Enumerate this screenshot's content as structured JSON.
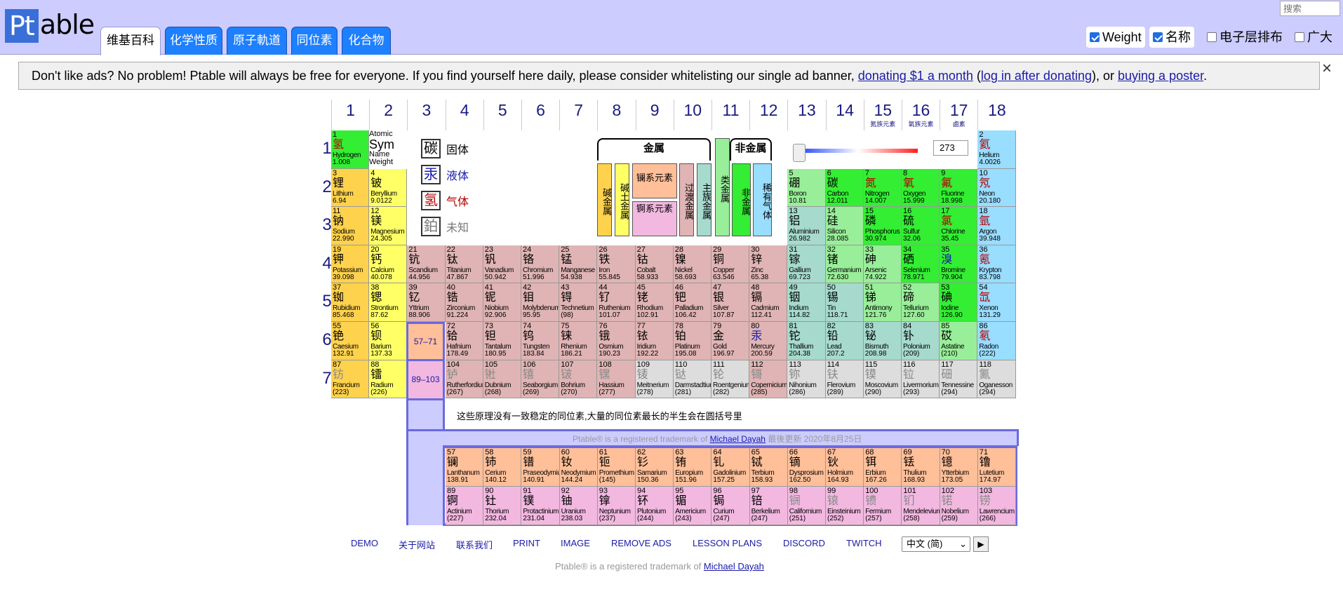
{
  "header": {
    "logo_pt": "Pt",
    "logo_rest": "able",
    "tabs": [
      "维基百科",
      "化学性质",
      "原子軌道",
      "同位素",
      "化合物"
    ],
    "search_placeholder": "搜索",
    "options": [
      {
        "label": "Weight",
        "checked": true
      },
      {
        "label": "名称",
        "checked": true
      },
      {
        "label": "电子层排布",
        "checked": false
      },
      {
        "label": "广大",
        "checked": false
      }
    ]
  },
  "ad": {
    "text1": "Don't like ads? No problem! Ptable will always be free for everyone. If you find yourself here daily, please consider whitelisting our single ad banner, ",
    "link1": "donating $1 a month",
    "text2": " (",
    "link2": "log in after donating",
    "text3": "), or ",
    "link3": "buying a poster",
    "text4": ".",
    "close": "×"
  },
  "groups": [
    "1",
    "2",
    "3",
    "4",
    "5",
    "6",
    "7",
    "8",
    "9",
    "10",
    "11",
    "12",
    "13",
    "14",
    "15",
    "16",
    "17",
    "18"
  ],
  "group_subs": {
    "15": "氮族元素",
    "16": "氧族元素",
    "17": "鹵素"
  },
  "periods": [
    "1",
    "2",
    "3",
    "4",
    "5",
    "6",
    "7"
  ],
  "key": {
    "num": "Atomic",
    "sym": "Sym",
    "name": "Name",
    "weight": "Weight"
  },
  "states": [
    {
      "sym": "碳",
      "label": "固体",
      "color": "#000000"
    },
    {
      "sym": "汞",
      "label": "液体",
      "color": "#1a1aaa"
    },
    {
      "sym": "氢",
      "label": "气体",
      "color": "#b00000"
    },
    {
      "sym": "鉑",
      "label": "未知",
      "color": "#777777"
    }
  ],
  "legend": {
    "metals": "金属",
    "metalloid": "类金属",
    "nonmetals": "非金属",
    "alkali": "碱金属",
    "alkaline": "碱土金属",
    "lanthanide": "镧系元素",
    "actinide": "锕系元素",
    "transition": "过渡金属",
    "post_transition": "主族金属",
    "other_nonmetal": "非金属",
    "noble": "稀有气体"
  },
  "temperature": "273",
  "lanth_ref": "57–71",
  "act_ref": "89–103",
  "note": "这些原理没有一致稳定的同位素,大量的同位素最长的半生会在圆括号里",
  "trademark_mid": "Ptable® is a registered trademark of ",
  "trademark_name": "Michael Dayah",
  "updated": "  最後更新 2020年8月25日",
  "footer_links": [
    "DEMO",
    "关于网站",
    "联系我们",
    "PRINT",
    "IMAGE",
    "REMOVE ADS",
    "LESSON PLANS",
    "DISCORD",
    "TWITCH"
  ],
  "language": "中文 (简)",
  "go": "▶",
  "trademark_bottom": "Ptable® is a registered trademark of ",
  "colors": {
    "alkali": "#ffd24d",
    "alkaline": "#ffff66",
    "transition": "#e0b4b4",
    "post": "#a6dacc",
    "metalloid": "#99ee99",
    "nonmetal": "#33ee33",
    "noble": "#99ddff",
    "lanthanide": "#ffbf99",
    "actinide": "#f2b8e0",
    "unknown": "#dddddd",
    "hydrogen": "#33ee33"
  },
  "elements": [
    {
      "n": "1",
      "s": "氢",
      "name": "Hydrogen",
      "w": "1.008",
      "g": 1,
      "p": 1,
      "c": "hydrogen",
      "st": "gas"
    },
    {
      "n": "2",
      "s": "氦",
      "name": "Helium",
      "w": "4.0026",
      "g": 18,
      "p": 1,
      "c": "noble",
      "st": "gas"
    },
    {
      "n": "3",
      "s": "锂",
      "name": "Lithium",
      "w": "6.94",
      "g": 1,
      "p": 2,
      "c": "alkali",
      "st": "solid"
    },
    {
      "n": "4",
      "s": "铍",
      "name": "Beryllium",
      "w": "9.0122",
      "g": 2,
      "p": 2,
      "c": "alkaline",
      "st": "solid"
    },
    {
      "n": "5",
      "s": "硼",
      "name": "Boron",
      "w": "10.81",
      "g": 13,
      "p": 2,
      "c": "metalloid",
      "st": "solid"
    },
    {
      "n": "6",
      "s": "碳",
      "name": "Carbon",
      "w": "12.011",
      "g": 14,
      "p": 2,
      "c": "nonmetal",
      "st": "solid"
    },
    {
      "n": "7",
      "s": "氮",
      "name": "Nitrogen",
      "w": "14.007",
      "g": 15,
      "p": 2,
      "c": "nonmetal",
      "st": "gas"
    },
    {
      "n": "8",
      "s": "氧",
      "name": "Oxygen",
      "w": "15.999",
      "g": 16,
      "p": 2,
      "c": "nonmetal",
      "st": "gas"
    },
    {
      "n": "9",
      "s": "氟",
      "name": "Fluorine",
      "w": "18.998",
      "g": 17,
      "p": 2,
      "c": "nonmetal",
      "st": "gas"
    },
    {
      "n": "10",
      "s": "氖",
      "name": "Neon",
      "w": "20.180",
      "g": 18,
      "p": 2,
      "c": "noble",
      "st": "gas"
    },
    {
      "n": "11",
      "s": "钠",
      "name": "Sodium",
      "w": "22.990",
      "g": 1,
      "p": 3,
      "c": "alkali",
      "st": "solid"
    },
    {
      "n": "12",
      "s": "镁",
      "name": "Magnesium",
      "w": "24.305",
      "g": 2,
      "p": 3,
      "c": "alkaline",
      "st": "solid"
    },
    {
      "n": "13",
      "s": "铝",
      "name": "Aluminium",
      "w": "26.982",
      "g": 13,
      "p": 3,
      "c": "post",
      "st": "solid"
    },
    {
      "n": "14",
      "s": "硅",
      "name": "Silicon",
      "w": "28.085",
      "g": 14,
      "p": 3,
      "c": "metalloid",
      "st": "solid"
    },
    {
      "n": "15",
      "s": "磷",
      "name": "Phosphorus",
      "w": "30.974",
      "g": 15,
      "p": 3,
      "c": "nonmetal",
      "st": "solid"
    },
    {
      "n": "16",
      "s": "硫",
      "name": "Sulfur",
      "w": "32.06",
      "g": 16,
      "p": 3,
      "c": "nonmetal",
      "st": "solid"
    },
    {
      "n": "17",
      "s": "氯",
      "name": "Chlorine",
      "w": "35.45",
      "g": 17,
      "p": 3,
      "c": "nonmetal",
      "st": "gas"
    },
    {
      "n": "18",
      "s": "氩",
      "name": "Argon",
      "w": "39.948",
      "g": 18,
      "p": 3,
      "c": "noble",
      "st": "gas"
    },
    {
      "n": "19",
      "s": "钾",
      "name": "Potassium",
      "w": "39.098",
      "g": 1,
      "p": 4,
      "c": "alkali",
      "st": "solid"
    },
    {
      "n": "20",
      "s": "钙",
      "name": "Calcium",
      "w": "40.078",
      "g": 2,
      "p": 4,
      "c": "alkaline",
      "st": "solid"
    },
    {
      "n": "21",
      "s": "钪",
      "name": "Scandium",
      "w": "44.956",
      "g": 3,
      "p": 4,
      "c": "transition",
      "st": "solid"
    },
    {
      "n": "22",
      "s": "钛",
      "name": "Titanium",
      "w": "47.867",
      "g": 4,
      "p": 4,
      "c": "transition",
      "st": "solid"
    },
    {
      "n": "23",
      "s": "钒",
      "name": "Vanadium",
      "w": "50.942",
      "g": 5,
      "p": 4,
      "c": "transition",
      "st": "solid"
    },
    {
      "n": "24",
      "s": "铬",
      "name": "Chromium",
      "w": "51.996",
      "g": 6,
      "p": 4,
      "c": "transition",
      "st": "solid"
    },
    {
      "n": "25",
      "s": "锰",
      "name": "Manganese",
      "w": "54.938",
      "g": 7,
      "p": 4,
      "c": "transition",
      "st": "solid"
    },
    {
      "n": "26",
      "s": "铁",
      "name": "Iron",
      "w": "55.845",
      "g": 8,
      "p": 4,
      "c": "transition",
      "st": "solid"
    },
    {
      "n": "27",
      "s": "钴",
      "name": "Cobalt",
      "w": "58.933",
      "g": 9,
      "p": 4,
      "c": "transition",
      "st": "solid"
    },
    {
      "n": "28",
      "s": "镍",
      "name": "Nickel",
      "w": "58.693",
      "g": 10,
      "p": 4,
      "c": "transition",
      "st": "solid"
    },
    {
      "n": "29",
      "s": "铜",
      "name": "Copper",
      "w": "63.546",
      "g": 11,
      "p": 4,
      "c": "transition",
      "st": "solid"
    },
    {
      "n": "30",
      "s": "锌",
      "name": "Zinc",
      "w": "65.38",
      "g": 12,
      "p": 4,
      "c": "transition",
      "st": "solid"
    },
    {
      "n": "31",
      "s": "镓",
      "name": "Gallium",
      "w": "69.723",
      "g": 13,
      "p": 4,
      "c": "post",
      "st": "solid"
    },
    {
      "n": "32",
      "s": "锗",
      "name": "Germanium",
      "w": "72.630",
      "g": 14,
      "p": 4,
      "c": "metalloid",
      "st": "solid"
    },
    {
      "n": "33",
      "s": "砷",
      "name": "Arsenic",
      "w": "74.922",
      "g": 15,
      "p": 4,
      "c": "metalloid",
      "st": "solid"
    },
    {
      "n": "34",
      "s": "硒",
      "name": "Selenium",
      "w": "78.971",
      "g": 16,
      "p": 4,
      "c": "nonmetal",
      "st": "solid"
    },
    {
      "n": "35",
      "s": "溴",
      "name": "Bromine",
      "w": "79.904",
      "g": 17,
      "p": 4,
      "c": "nonmetal",
      "st": "liquid"
    },
    {
      "n": "36",
      "s": "氪",
      "name": "Krypton",
      "w": "83.798",
      "g": 18,
      "p": 4,
      "c": "noble",
      "st": "gas"
    },
    {
      "n": "37",
      "s": "铷",
      "name": "Rubidium",
      "w": "85.468",
      "g": 1,
      "p": 5,
      "c": "alkali",
      "st": "solid"
    },
    {
      "n": "38",
      "s": "锶",
      "name": "Strontium",
      "w": "87.62",
      "g": 2,
      "p": 5,
      "c": "alkaline",
      "st": "solid"
    },
    {
      "n": "39",
      "s": "钇",
      "name": "Yttrium",
      "w": "88.906",
      "g": 3,
      "p": 5,
      "c": "transition",
      "st": "solid"
    },
    {
      "n": "40",
      "s": "锆",
      "name": "Zirconium",
      "w": "91.224",
      "g": 4,
      "p": 5,
      "c": "transition",
      "st": "solid"
    },
    {
      "n": "41",
      "s": "铌",
      "name": "Niobium",
      "w": "92.906",
      "g": 5,
      "p": 5,
      "c": "transition",
      "st": "solid"
    },
    {
      "n": "42",
      "s": "钼",
      "name": "Molybdenum",
      "w": "95.95",
      "g": 6,
      "p": 5,
      "c": "transition",
      "st": "solid"
    },
    {
      "n": "43",
      "s": "锝",
      "name": "Technetium",
      "w": "(98)",
      "g": 7,
      "p": 5,
      "c": "transition",
      "st": "solid"
    },
    {
      "n": "44",
      "s": "钌",
      "name": "Ruthenium",
      "w": "101.07",
      "g": 8,
      "p": 5,
      "c": "transition",
      "st": "solid"
    },
    {
      "n": "45",
      "s": "铑",
      "name": "Rhodium",
      "w": "102.91",
      "g": 9,
      "p": 5,
      "c": "transition",
      "st": "solid"
    },
    {
      "n": "46",
      "s": "钯",
      "name": "Palladium",
      "w": "106.42",
      "g": 10,
      "p": 5,
      "c": "transition",
      "st": "solid"
    },
    {
      "n": "47",
      "s": "银",
      "name": "Silver",
      "w": "107.87",
      "g": 11,
      "p": 5,
      "c": "transition",
      "st": "solid"
    },
    {
      "n": "48",
      "s": "镉",
      "name": "Cadmium",
      "w": "112.41",
      "g": 12,
      "p": 5,
      "c": "transition",
      "st": "solid"
    },
    {
      "n": "49",
      "s": "铟",
      "name": "Indium",
      "w": "114.82",
      "g": 13,
      "p": 5,
      "c": "post",
      "st": "solid"
    },
    {
      "n": "50",
      "s": "锡",
      "name": "Tin",
      "w": "118.71",
      "g": 14,
      "p": 5,
      "c": "post",
      "st": "solid"
    },
    {
      "n": "51",
      "s": "锑",
      "name": "Antimony",
      "w": "121.76",
      "g": 15,
      "p": 5,
      "c": "metalloid",
      "st": "solid"
    },
    {
      "n": "52",
      "s": "碲",
      "name": "Tellurium",
      "w": "127.60",
      "g": 16,
      "p": 5,
      "c": "metalloid",
      "st": "solid"
    },
    {
      "n": "53",
      "s": "碘",
      "name": "Iodine",
      "w": "126.90",
      "g": 17,
      "p": 5,
      "c": "nonmetal",
      "st": "solid"
    },
    {
      "n": "54",
      "s": "氙",
      "name": "Xenon",
      "w": "131.29",
      "g": 18,
      "p": 5,
      "c": "noble",
      "st": "gas"
    },
    {
      "n": "55",
      "s": "铯",
      "name": "Caesium",
      "w": "132.91",
      "g": 1,
      "p": 6,
      "c": "alkali",
      "st": "solid"
    },
    {
      "n": "56",
      "s": "钡",
      "name": "Barium",
      "w": "137.33",
      "g": 2,
      "p": 6,
      "c": "alkaline",
      "st": "solid"
    },
    {
      "n": "72",
      "s": "铪",
      "name": "Hafnium",
      "w": "178.49",
      "g": 4,
      "p": 6,
      "c": "transition",
      "st": "solid"
    },
    {
      "n": "73",
      "s": "钽",
      "name": "Tantalum",
      "w": "180.95",
      "g": 5,
      "p": 6,
      "c": "transition",
      "st": "solid"
    },
    {
      "n": "74",
      "s": "钨",
      "name": "Tungsten",
      "w": "183.84",
      "g": 6,
      "p": 6,
      "c": "transition",
      "st": "solid"
    },
    {
      "n": "75",
      "s": "铼",
      "name": "Rhenium",
      "w": "186.21",
      "g": 7,
      "p": 6,
      "c": "transition",
      "st": "solid"
    },
    {
      "n": "76",
      "s": "锇",
      "name": "Osmium",
      "w": "190.23",
      "g": 8,
      "p": 6,
      "c": "transition",
      "st": "solid"
    },
    {
      "n": "77",
      "s": "铱",
      "name": "Iridium",
      "w": "192.22",
      "g": 9,
      "p": 6,
      "c": "transition",
      "st": "solid"
    },
    {
      "n": "78",
      "s": "铂",
      "name": "Platinum",
      "w": "195.08",
      "g": 10,
      "p": 6,
      "c": "transition",
      "st": "solid"
    },
    {
      "n": "79",
      "s": "金",
      "name": "Gold",
      "w": "196.97",
      "g": 11,
      "p": 6,
      "c": "transition",
      "st": "solid"
    },
    {
      "n": "80",
      "s": "汞",
      "name": "Mercury",
      "w": "200.59",
      "g": 12,
      "p": 6,
      "c": "transition",
      "st": "liquid"
    },
    {
      "n": "81",
      "s": "铊",
      "name": "Thallium",
      "w": "204.38",
      "g": 13,
      "p": 6,
      "c": "post",
      "st": "solid"
    },
    {
      "n": "82",
      "s": "铅",
      "name": "Lead",
      "w": "207.2",
      "g": 14,
      "p": 6,
      "c": "post",
      "st": "solid"
    },
    {
      "n": "83",
      "s": "铋",
      "name": "Bismuth",
      "w": "208.98",
      "g": 15,
      "p": 6,
      "c": "post",
      "st": "solid"
    },
    {
      "n": "84",
      "s": "钋",
      "name": "Polonium",
      "w": "(209)",
      "g": 16,
      "p": 6,
      "c": "post",
      "st": "solid"
    },
    {
      "n": "85",
      "s": "砹",
      "name": "Astatine",
      "w": "(210)",
      "g": 17,
      "p": 6,
      "c": "metalloid",
      "st": "solid"
    },
    {
      "n": "86",
      "s": "氡",
      "name": "Radon",
      "w": "(222)",
      "g": 18,
      "p": 6,
      "c": "noble",
      "st": "gas"
    },
    {
      "n": "87",
      "s": "钫",
      "name": "Francium",
      "w": "(223)",
      "g": 1,
      "p": 7,
      "c": "alkali",
      "st": "unknown"
    },
    {
      "n": "88",
      "s": "镭",
      "name": "Radium",
      "w": "(226)",
      "g": 2,
      "p": 7,
      "c": "alkaline",
      "st": "solid"
    },
    {
      "n": "104",
      "s": "𬬻",
      "name": "Rutherfordium",
      "w": "(267)",
      "g": 4,
      "p": 7,
      "c": "transition",
      "st": "unknown"
    },
    {
      "n": "105",
      "s": "𬭊",
      "name": "Dubnium",
      "w": "(268)",
      "g": 5,
      "p": 7,
      "c": "transition",
      "st": "unknown"
    },
    {
      "n": "106",
      "s": "𬭳",
      "name": "Seaborgium",
      "w": "(269)",
      "g": 6,
      "p": 7,
      "c": "transition",
      "st": "unknown"
    },
    {
      "n": "107",
      "s": "𬭛",
      "name": "Bohrium",
      "w": "(270)",
      "g": 7,
      "p": 7,
      "c": "transition",
      "st": "unknown"
    },
    {
      "n": "108",
      "s": "𬭶",
      "name": "Hassium",
      "w": "(277)",
      "g": 8,
      "p": 7,
      "c": "transition",
      "st": "unknown"
    },
    {
      "n": "109",
      "s": "鿏",
      "name": "Meitnerium",
      "w": "(278)",
      "g": 9,
      "p": 7,
      "c": "unknown",
      "st": "unknown"
    },
    {
      "n": "110",
      "s": "𫟼",
      "name": "Darmstadtium",
      "w": "(281)",
      "g": 10,
      "p": 7,
      "c": "unknown",
      "st": "unknown"
    },
    {
      "n": "111",
      "s": "𬬭",
      "name": "Roentgenium",
      "w": "(282)",
      "g": 11,
      "p": 7,
      "c": "unknown",
      "st": "unknown"
    },
    {
      "n": "112",
      "s": "鿔",
      "name": "Copernicium",
      "w": "(285)",
      "g": 12,
      "p": 7,
      "c": "transition",
      "st": "unknown"
    },
    {
      "n": "113",
      "s": "鿭",
      "name": "Nihonium",
      "w": "(286)",
      "g": 13,
      "p": 7,
      "c": "unknown",
      "st": "unknown"
    },
    {
      "n": "114",
      "s": "𫓧",
      "name": "Flerovium",
      "w": "(289)",
      "g": 14,
      "p": 7,
      "c": "unknown",
      "st": "unknown"
    },
    {
      "n": "115",
      "s": "镆",
      "name": "Moscovium",
      "w": "(290)",
      "g": 15,
      "p": 7,
      "c": "unknown",
      "st": "unknown"
    },
    {
      "n": "116",
      "s": "𫟷",
      "name": "Livermorium",
      "w": "(293)",
      "g": 16,
      "p": 7,
      "c": "unknown",
      "st": "unknown"
    },
    {
      "n": "117",
      "s": "鿬",
      "name": "Tennessine",
      "w": "(294)",
      "g": 17,
      "p": 7,
      "c": "unknown",
      "st": "unknown"
    },
    {
      "n": "118",
      "s": "鿫",
      "name": "Oganesson",
      "w": "(294)",
      "g": 18,
      "p": 7,
      "c": "unknown",
      "st": "unknown"
    }
  ],
  "lanthanides": [
    {
      "n": "57",
      "s": "镧",
      "name": "Lanthanum",
      "w": "138.91"
    },
    {
      "n": "58",
      "s": "铈",
      "name": "Cerium",
      "w": "140.12"
    },
    {
      "n": "59",
      "s": "镨",
      "name": "Praseodymium",
      "w": "140.91"
    },
    {
      "n": "60",
      "s": "钕",
      "name": "Neodymium",
      "w": "144.24"
    },
    {
      "n": "61",
      "s": "钷",
      "name": "Promethium",
      "w": "(145)"
    },
    {
      "n": "62",
      "s": "钐",
      "name": "Samarium",
      "w": "150.36"
    },
    {
      "n": "63",
      "s": "铕",
      "name": "Europium",
      "w": "151.96"
    },
    {
      "n": "64",
      "s": "钆",
      "name": "Gadolinium",
      "w": "157.25"
    },
    {
      "n": "65",
      "s": "铽",
      "name": "Terbium",
      "w": "158.93"
    },
    {
      "n": "66",
      "s": "镝",
      "name": "Dysprosium",
      "w": "162.50"
    },
    {
      "n": "67",
      "s": "钬",
      "name": "Holmium",
      "w": "164.93"
    },
    {
      "n": "68",
      "s": "铒",
      "name": "Erbium",
      "w": "167.26"
    },
    {
      "n": "69",
      "s": "铥",
      "name": "Thulium",
      "w": "168.93"
    },
    {
      "n": "70",
      "s": "镱",
      "name": "Ytterbium",
      "w": "173.05"
    },
    {
      "n": "71",
      "s": "镥",
      "name": "Lutetium",
      "w": "174.97"
    }
  ],
  "actinides": [
    {
      "n": "89",
      "s": "锕",
      "name": "Actinium",
      "w": "(227)"
    },
    {
      "n": "90",
      "s": "钍",
      "name": "Thorium",
      "w": "232.04"
    },
    {
      "n": "91",
      "s": "镤",
      "name": "Protactinium",
      "w": "231.04"
    },
    {
      "n": "92",
      "s": "铀",
      "name": "Uranium",
      "w": "238.03"
    },
    {
      "n": "93",
      "s": "镎",
      "name": "Neptunium",
      "w": "(237)"
    },
    {
      "n": "94",
      "s": "钚",
      "name": "Plutonium",
      "w": "(244)"
    },
    {
      "n": "95",
      "s": "镅",
      "name": "Americium",
      "w": "(243)"
    },
    {
      "n": "96",
      "s": "锔",
      "name": "Curium",
      "w": "(247)"
    },
    {
      "n": "97",
      "s": "锫",
      "name": "Berkelium",
      "w": "(247)"
    },
    {
      "n": "98",
      "s": "锎",
      "name": "Californium",
      "w": "(251)"
    },
    {
      "n": "99",
      "s": "锿",
      "name": "Einsteinium",
      "w": "(252)"
    },
    {
      "n": "100",
      "s": "镄",
      "name": "Fermium",
      "w": "(257)"
    },
    {
      "n": "101",
      "s": "钔",
      "name": "Mendelevium",
      "w": "(258)"
    },
    {
      "n": "102",
      "s": "锘",
      "name": "Nobelium",
      "w": "(259)"
    },
    {
      "n": "103",
      "s": "铹",
      "name": "Lawrencium",
      "w": "(266)"
    }
  ]
}
